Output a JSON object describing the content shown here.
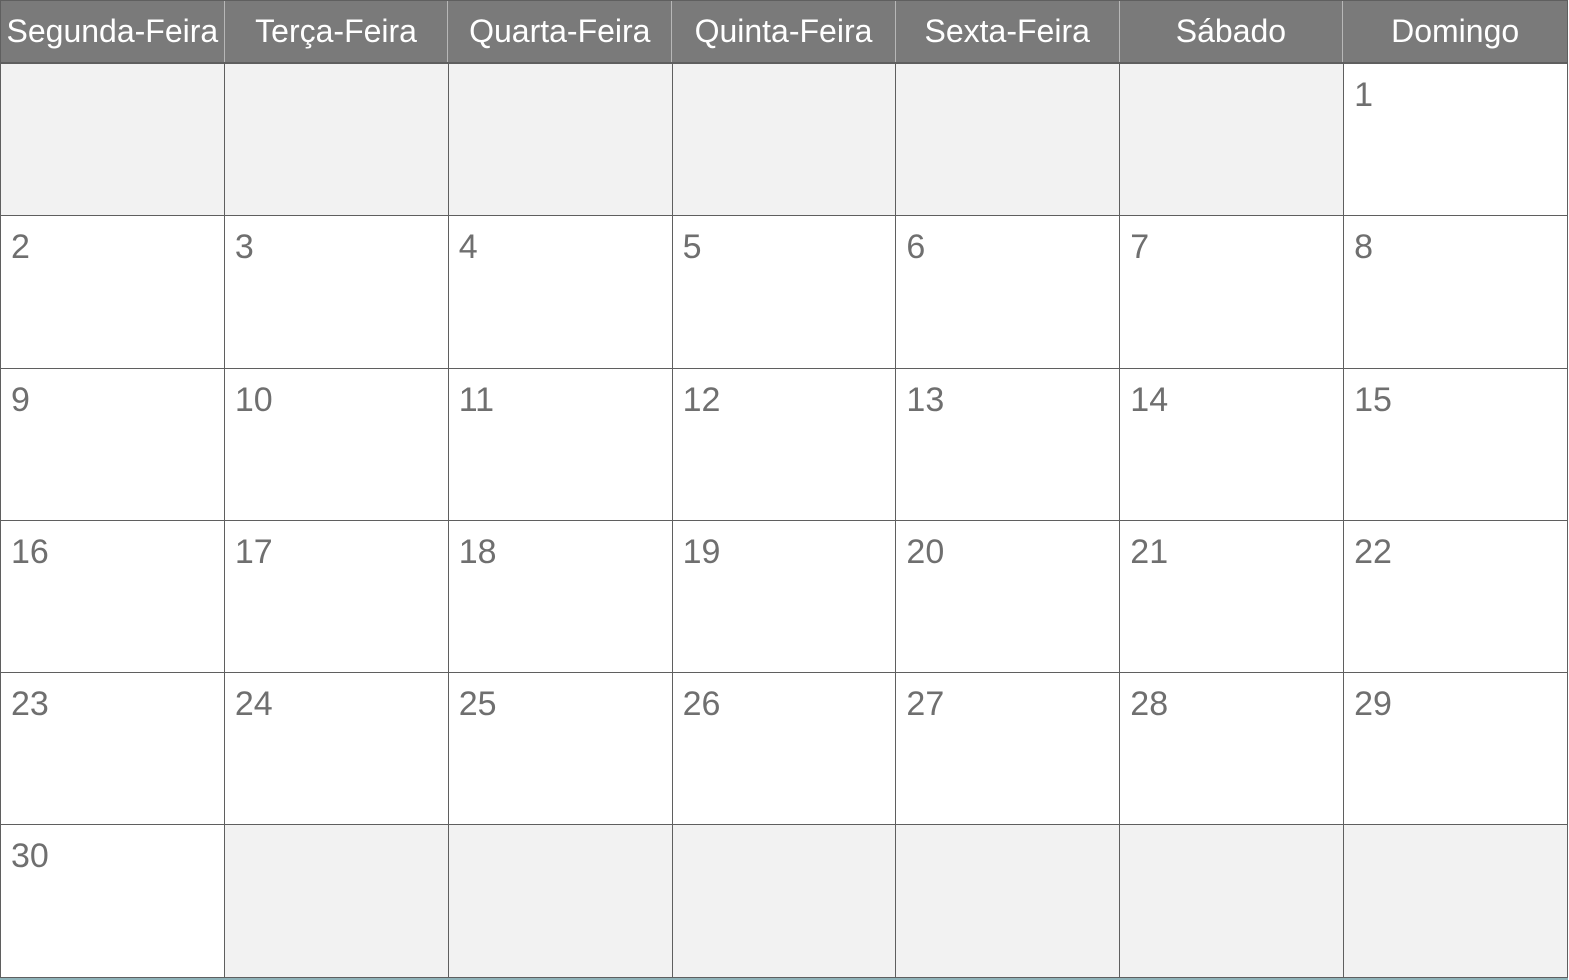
{
  "colors": {
    "header_bg": "#7a7a7a",
    "header_text": "#ffffff",
    "grid_line": "#5f5f5f",
    "empty_cell_bg": "#f2f2f2",
    "day_number": "#6f6f6f"
  },
  "weekdays": [
    "Segunda-Feira",
    "Terça-Feira",
    "Quarta-Feira",
    "Quinta-Feira",
    "Sexta-Feira",
    "Sábado",
    "Domingo"
  ],
  "weeks": [
    [
      "",
      "",
      "",
      "",
      "",
      "",
      "1"
    ],
    [
      "2",
      "3",
      "4",
      "5",
      "6",
      "7",
      "8"
    ],
    [
      "9",
      "10",
      "11",
      "12",
      "13",
      "14",
      "15"
    ],
    [
      "16",
      "17",
      "18",
      "19",
      "20",
      "21",
      "22"
    ],
    [
      "23",
      "24",
      "25",
      "26",
      "27",
      "28",
      "29"
    ],
    [
      "30",
      "",
      "",
      "",
      "",
      "",
      ""
    ]
  ]
}
